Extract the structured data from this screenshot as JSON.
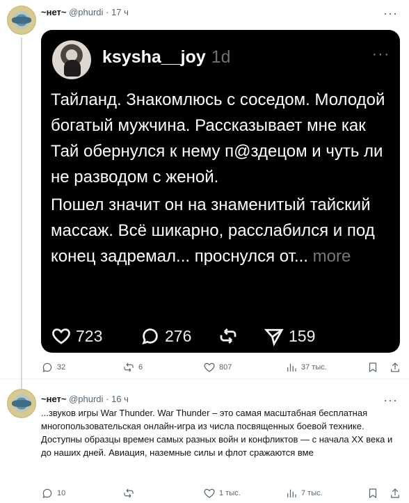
{
  "first_tweet": {
    "name": "~нет~",
    "handle": "@phurdi",
    "time": "17 ч",
    "card": {
      "user": "ksysha__joy",
      "time": "1d",
      "paragraph1": "Тайланд. Знакомлюсь с соседом. Молодой богатый мужчина. Рассказывает мне как Тай обернулся к нему п@здецом и чуть ли не разводом с женой.",
      "paragraph2": "Пошел значит он на знаменитый тайский массаж. Всё шикарно, расслабился и под конец задремал... проснулся от...",
      "more": "more",
      "likes": "723",
      "comments": "276",
      "shares": "159"
    },
    "replies": "32",
    "reposts": "6",
    "likes": "807",
    "views": "37 тыс."
  },
  "second_tweet": {
    "name": "~нет~",
    "handle": "@phurdi",
    "time": "16 ч",
    "text": "...звуков игры War Thunder. War Thunder – это  самая масштабная бесплатная многопользовательская онлайн-игра из числа посвященных боевой технике. Доступны образцы времен самых разных войн и конфликтов — с начала XX века и до наших дней. Авиация, наземные силы и флот сражаются вме",
    "replies": "10",
    "likes": "1 тыс.",
    "views": "7 тыс."
  },
  "icons": [
    "avatar",
    "more-icon",
    "heart-icon",
    "comment-icon",
    "repost-icon",
    "send-icon",
    "views-icon",
    "bookmark-icon",
    "share-icon"
  ]
}
